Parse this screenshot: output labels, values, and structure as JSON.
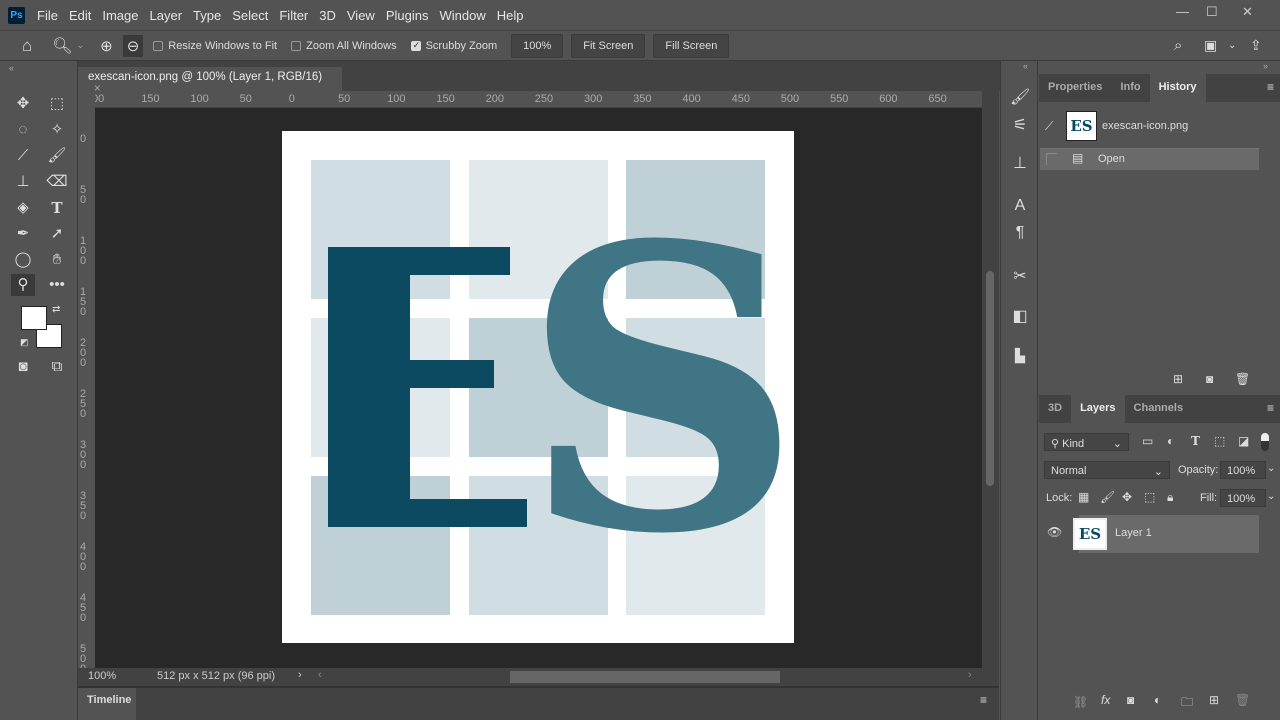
{
  "app": {
    "logo": "Ps",
    "menu": [
      "File",
      "Edit",
      "Image",
      "Layer",
      "Type",
      "Select",
      "Filter",
      "3D",
      "View",
      "Plugins",
      "Window",
      "Help"
    ],
    "window_controls": [
      "—",
      "☐",
      "✕"
    ]
  },
  "options": {
    "resize_windows": "Resize Windows to Fit",
    "resize_checked": false,
    "zoom_all": "Zoom All Windows",
    "zoom_all_checked": false,
    "scrubby": "Scrubby Zoom",
    "scrubby_checked": true,
    "zoom_value": "100%",
    "fit_screen": "Fit Screen",
    "fill_screen": "Fill Screen"
  },
  "document": {
    "tab_title": "exescan-icon.png @ 100% (Layer 1, RGB/16)",
    "close": "×",
    "ruler_top": [
      "00",
      "150",
      "100",
      "50",
      "0",
      "50",
      "100",
      "150",
      "200",
      "250",
      "300",
      "350",
      "400",
      "450",
      "500",
      "550",
      "600",
      "650"
    ],
    "ruler_left": [
      "0",
      "50",
      "100",
      "150",
      "200",
      "250",
      "300",
      "350",
      "400",
      "450",
      "500"
    ],
    "image": {
      "letters": [
        "E",
        "S"
      ],
      "colors": {
        "background": "#ffffff",
        "tile_light": "#e2e9ec",
        "tile_mid": "#d0dde2",
        "tile_dark": "#bfd1d7",
        "e_color": "#0b4a60",
        "s_color": "#3f7585"
      }
    }
  },
  "status": {
    "zoom": "100%",
    "doc_info": "512 px x 512 px (96 ppi)"
  },
  "timeline": {
    "label": "Timeline"
  },
  "history_panel": {
    "tabs": [
      "Properties",
      "Info",
      "History"
    ],
    "active": "History",
    "snapshot": "exescan-icon.png",
    "snapshot_thumb": "ES",
    "states": [
      "Open"
    ]
  },
  "layers_panel": {
    "tabs": [
      "3D",
      "Layers",
      "Channels"
    ],
    "active": "Layers",
    "filter": "Kind",
    "blend_mode": "Normal",
    "opacity_label": "Opacity:",
    "opacity": "100%",
    "lock_label": "Lock:",
    "fill_label": "Fill:",
    "fill": "100%",
    "layers": [
      {
        "name": "Layer 1",
        "thumb": "ES",
        "visible": true
      }
    ]
  }
}
